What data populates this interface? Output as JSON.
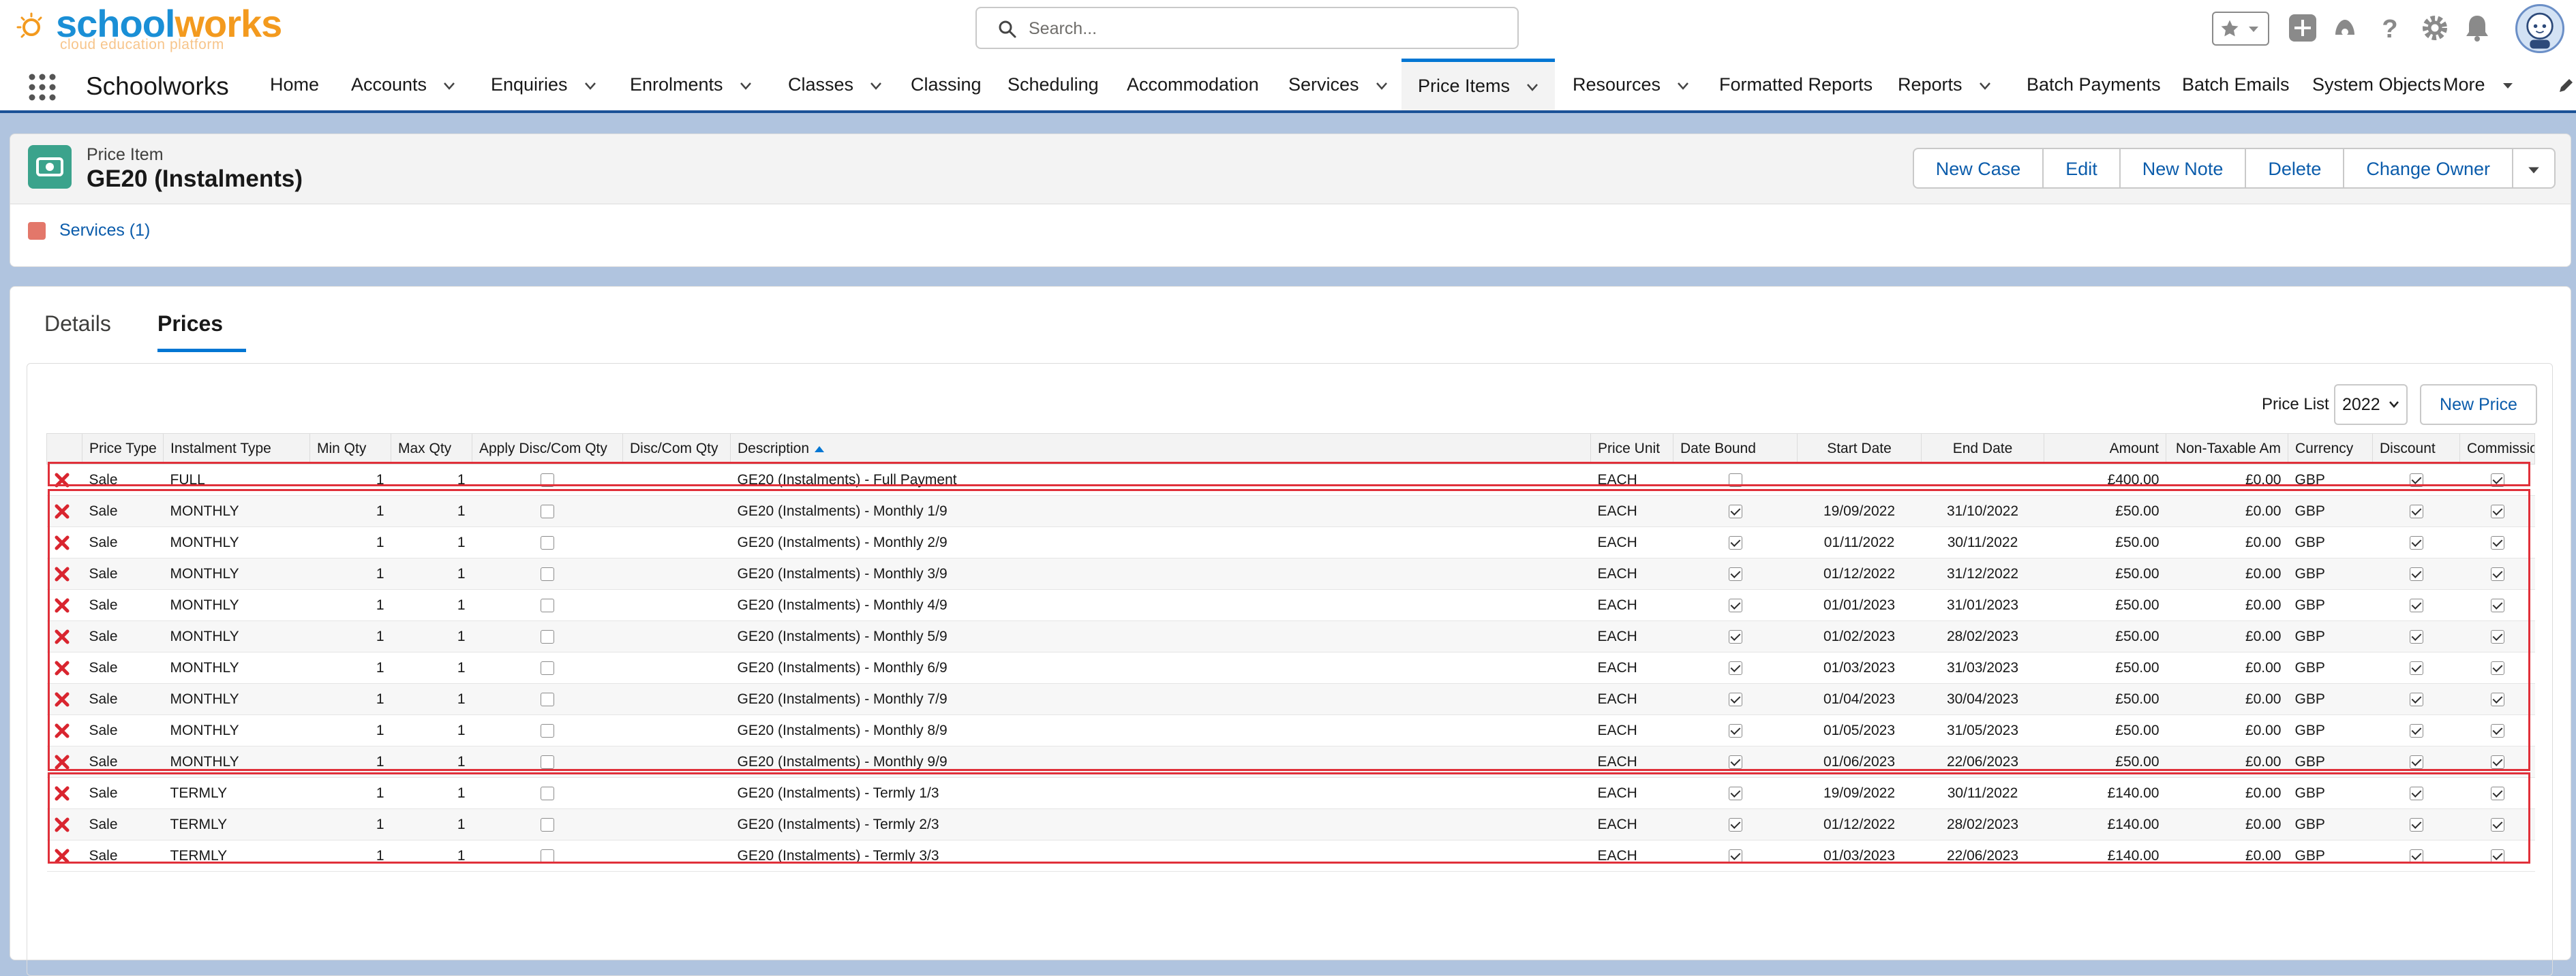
{
  "header": {
    "logo_school": "school",
    "logo_works": "works",
    "logo_tagline": "cloud education platform",
    "search_placeholder": "Search...",
    "icons": [
      "favorites-star-icon",
      "add-icon",
      "trailhead-icon",
      "help-icon",
      "settings-icon",
      "notifications-bell-icon",
      "avatar"
    ]
  },
  "nav": {
    "app_name": "Schoolworks",
    "items": [
      {
        "label": "Home",
        "chevron": false
      },
      {
        "label": "Accounts",
        "chevron": true
      },
      {
        "label": "Enquiries",
        "chevron": true
      },
      {
        "label": "Enrolments",
        "chevron": true
      },
      {
        "label": "Classes",
        "chevron": true
      },
      {
        "label": "Classing",
        "chevron": false
      },
      {
        "label": "Scheduling",
        "chevron": false
      },
      {
        "label": "Accommodation",
        "chevron": false
      },
      {
        "label": "Services",
        "chevron": true
      },
      {
        "label": "Price Items",
        "chevron": true,
        "active": true
      },
      {
        "label": "Resources",
        "chevron": true
      },
      {
        "label": "Formatted Reports",
        "chevron": false
      },
      {
        "label": "Reports",
        "chevron": true
      },
      {
        "label": "Batch Payments",
        "chevron": false
      },
      {
        "label": "Batch Emails",
        "chevron": false
      },
      {
        "label": "System Objects",
        "chevron": false
      },
      {
        "label": "More",
        "chevron": true
      }
    ]
  },
  "record": {
    "object_type": "Price Item",
    "name": "GE20 (Instalments)",
    "actions": [
      "New Case",
      "Edit",
      "New Note",
      "Delete",
      "Change Owner"
    ],
    "related_link": "Services (1)"
  },
  "tabs": {
    "details": "Details",
    "prices": "Prices"
  },
  "price_list": {
    "label": "Price List",
    "selected": "2022",
    "new_button": "New Price"
  },
  "table": {
    "columns": [
      "",
      "Price Type",
      "Instalment Type",
      "Min Qty",
      "Max Qty",
      "Apply Disc/Com Qty",
      "Disc/Com Qty",
      "Description",
      "Price Unit",
      "Date Bound",
      "Start Date",
      "End Date",
      "Amount",
      "Non-Taxable Am",
      "Currency",
      "Discount",
      "Commission"
    ],
    "rows": [
      {
        "price_type": "Sale",
        "instalment_type": "FULL",
        "min_qty": "1",
        "max_qty": "1",
        "apply_disc": false,
        "disc_qty": "",
        "description": "GE20 (Instalments) - Full Payment",
        "price_unit": "EACH",
        "date_bound": false,
        "start": "",
        "end": "",
        "amount": "£400.00",
        "non_taxable": "£0.00",
        "currency": "GBP",
        "discount": true,
        "commission": true
      },
      {
        "price_type": "Sale",
        "instalment_type": "MONTHLY",
        "min_qty": "1",
        "max_qty": "1",
        "apply_disc": false,
        "disc_qty": "",
        "description": "GE20 (Instalments) - Monthly 1/9",
        "price_unit": "EACH",
        "date_bound": true,
        "start": "19/09/2022",
        "end": "31/10/2022",
        "amount": "£50.00",
        "non_taxable": "£0.00",
        "currency": "GBP",
        "discount": true,
        "commission": true
      },
      {
        "price_type": "Sale",
        "instalment_type": "MONTHLY",
        "min_qty": "1",
        "max_qty": "1",
        "apply_disc": false,
        "disc_qty": "",
        "description": "GE20 (Instalments) - Monthly 2/9",
        "price_unit": "EACH",
        "date_bound": true,
        "start": "01/11/2022",
        "end": "30/11/2022",
        "amount": "£50.00",
        "non_taxable": "£0.00",
        "currency": "GBP",
        "discount": true,
        "commission": true
      },
      {
        "price_type": "Sale",
        "instalment_type": "MONTHLY",
        "min_qty": "1",
        "max_qty": "1",
        "apply_disc": false,
        "disc_qty": "",
        "description": "GE20 (Instalments) - Monthly 3/9",
        "price_unit": "EACH",
        "date_bound": true,
        "start": "01/12/2022",
        "end": "31/12/2022",
        "amount": "£50.00",
        "non_taxable": "£0.00",
        "currency": "GBP",
        "discount": true,
        "commission": true
      },
      {
        "price_type": "Sale",
        "instalment_type": "MONTHLY",
        "min_qty": "1",
        "max_qty": "1",
        "apply_disc": false,
        "disc_qty": "",
        "description": "GE20 (Instalments) - Monthly 4/9",
        "price_unit": "EACH",
        "date_bound": true,
        "start": "01/01/2023",
        "end": "31/01/2023",
        "amount": "£50.00",
        "non_taxable": "£0.00",
        "currency": "GBP",
        "discount": true,
        "commission": true
      },
      {
        "price_type": "Sale",
        "instalment_type": "MONTHLY",
        "min_qty": "1",
        "max_qty": "1",
        "apply_disc": false,
        "disc_qty": "",
        "description": "GE20 (Instalments) - Monthly 5/9",
        "price_unit": "EACH",
        "date_bound": true,
        "start": "01/02/2023",
        "end": "28/02/2023",
        "amount": "£50.00",
        "non_taxable": "£0.00",
        "currency": "GBP",
        "discount": true,
        "commission": true
      },
      {
        "price_type": "Sale",
        "instalment_type": "MONTHLY",
        "min_qty": "1",
        "max_qty": "1",
        "apply_disc": false,
        "disc_qty": "",
        "description": "GE20 (Instalments) - Monthly 6/9",
        "price_unit": "EACH",
        "date_bound": true,
        "start": "01/03/2023",
        "end": "31/03/2023",
        "amount": "£50.00",
        "non_taxable": "£0.00",
        "currency": "GBP",
        "discount": true,
        "commission": true
      },
      {
        "price_type": "Sale",
        "instalment_type": "MONTHLY",
        "min_qty": "1",
        "max_qty": "1",
        "apply_disc": false,
        "disc_qty": "",
        "description": "GE20 (Instalments) - Monthly 7/9",
        "price_unit": "EACH",
        "date_bound": true,
        "start": "01/04/2023",
        "end": "30/04/2023",
        "amount": "£50.00",
        "non_taxable": "£0.00",
        "currency": "GBP",
        "discount": true,
        "commission": true
      },
      {
        "price_type": "Sale",
        "instalment_type": "MONTHLY",
        "min_qty": "1",
        "max_qty": "1",
        "apply_disc": false,
        "disc_qty": "",
        "description": "GE20 (Instalments) - Monthly 8/9",
        "price_unit": "EACH",
        "date_bound": true,
        "start": "01/05/2023",
        "end": "31/05/2023",
        "amount": "£50.00",
        "non_taxable": "£0.00",
        "currency": "GBP",
        "discount": true,
        "commission": true
      },
      {
        "price_type": "Sale",
        "instalment_type": "MONTHLY",
        "min_qty": "1",
        "max_qty": "1",
        "apply_disc": false,
        "disc_qty": "",
        "description": "GE20 (Instalments) - Monthly 9/9",
        "price_unit": "EACH",
        "date_bound": true,
        "start": "01/06/2023",
        "end": "22/06/2023",
        "amount": "£50.00",
        "non_taxable": "£0.00",
        "currency": "GBP",
        "discount": true,
        "commission": true
      },
      {
        "price_type": "Sale",
        "instalment_type": "TERMLY",
        "min_qty": "1",
        "max_qty": "1",
        "apply_disc": false,
        "disc_qty": "",
        "description": "GE20 (Instalments) - Termly 1/3",
        "price_unit": "EACH",
        "date_bound": true,
        "start": "19/09/2022",
        "end": "30/11/2022",
        "amount": "£140.00",
        "non_taxable": "£0.00",
        "currency": "GBP",
        "discount": true,
        "commission": true
      },
      {
        "price_type": "Sale",
        "instalment_type": "TERMLY",
        "min_qty": "1",
        "max_qty": "1",
        "apply_disc": false,
        "disc_qty": "",
        "description": "GE20 (Instalments) - Termly 2/3",
        "price_unit": "EACH",
        "date_bound": true,
        "start": "01/12/2022",
        "end": "28/02/2023",
        "amount": "£140.00",
        "non_taxable": "£0.00",
        "currency": "GBP",
        "discount": true,
        "commission": true
      },
      {
        "price_type": "Sale",
        "instalment_type": "TERMLY",
        "min_qty": "1",
        "max_qty": "1",
        "apply_disc": false,
        "disc_qty": "",
        "description": "GE20 (Instalments) - Termly 3/3",
        "price_unit": "EACH",
        "date_bound": true,
        "start": "01/03/2023",
        "end": "22/06/2023",
        "amount": "£140.00",
        "non_taxable": "£0.00",
        "currency": "GBP",
        "discount": true,
        "commission": true
      }
    ]
  },
  "colors": {
    "brand_blue": "#0176d3",
    "nav_border": "#1b5297",
    "highlight_red": "#e0303a",
    "record_icon": "#3ba38c"
  }
}
